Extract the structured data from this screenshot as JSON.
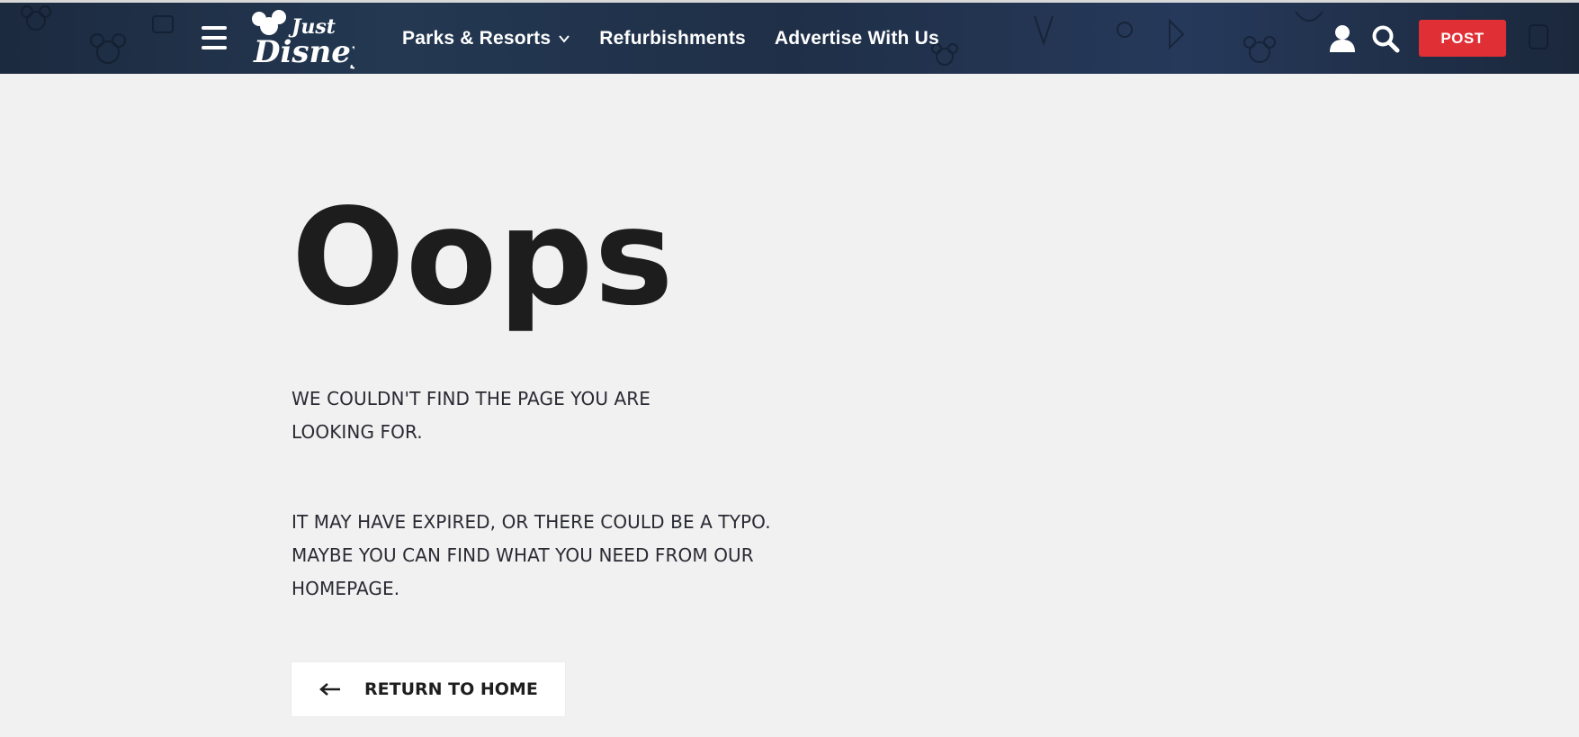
{
  "header": {
    "logo_alt": "Just Disney",
    "nav": [
      {
        "label": "Parks & Resorts",
        "has_dropdown": true
      },
      {
        "label": "Refurbishments",
        "has_dropdown": false
      },
      {
        "label": "Advertise With Us",
        "has_dropdown": false
      }
    ],
    "post_label": "POST",
    "icons": [
      "menu-icon",
      "user-icon",
      "search-icon",
      "chevron-down-icon"
    ],
    "colors": {
      "navbar": "#1f2f47",
      "post_button": "#e03036"
    }
  },
  "error": {
    "title": "Oops",
    "message1": "WE COULDN'T FIND THE PAGE YOU ARE LOOKING FOR.",
    "message2": "IT MAY HAVE EXPIRED, OR THERE COULD BE A TYPO. MAYBE YOU CAN FIND WHAT YOU NEED FROM OUR HOMEPAGE.",
    "return_label": "RETURN TO HOME"
  },
  "colors": {
    "page_background": "#f1f1f1",
    "text": "#222222"
  }
}
